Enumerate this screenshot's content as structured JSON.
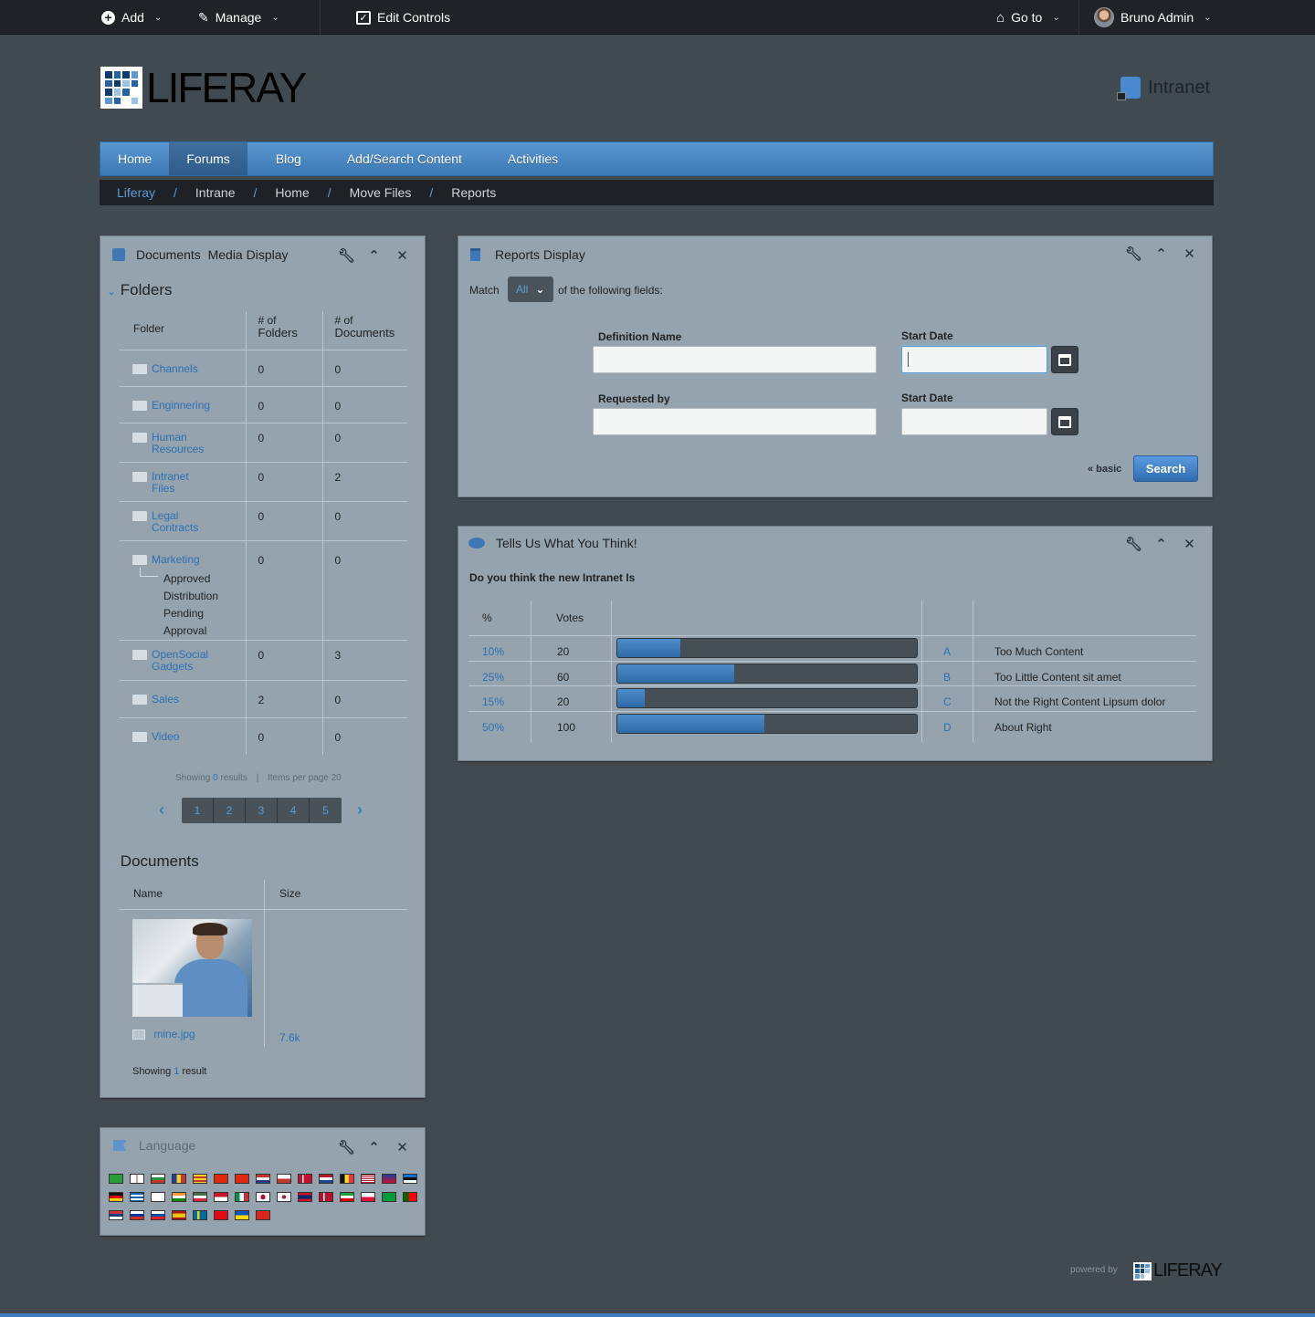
{
  "dockbar": {
    "add_label": "Add",
    "manage_label": "Manage",
    "edit_controls_label": "Edit Controls",
    "goto_label": "Go to",
    "user_name": "Bruno Admin"
  },
  "header": {
    "logo_text": "LIFERAY",
    "site_name": "Intranet"
  },
  "nav": {
    "items": [
      {
        "label": "Home"
      },
      {
        "label": "Forums",
        "selected": true
      },
      {
        "label": "Blog"
      },
      {
        "label": "Add/Search Content"
      },
      {
        "label": "Activities"
      }
    ]
  },
  "breadcrumb": {
    "items": [
      "Liferay",
      "Intrane",
      "Home",
      "Move Files",
      "Reports"
    ]
  },
  "documents_portlet": {
    "title": "Documents  Media Display",
    "folders_heading": "Folders",
    "col_folder": "Folder",
    "col_folders_1": "# of",
    "col_folders_2": "Folders",
    "col_docs_1": "# of",
    "col_docs_2": "Documents",
    "rows": [
      {
        "name1": "Channels",
        "name2": "",
        "folders": "0",
        "docs": "0"
      },
      {
        "name1": "Enginnering",
        "name2": "",
        "folders": "0",
        "docs": "0"
      },
      {
        "name1": "Human",
        "name2": "Resources",
        "folders": "0",
        "docs": "0"
      },
      {
        "name1": "Intranet",
        "name2": "Files",
        "folders": "0",
        "docs": "2"
      },
      {
        "name1": "Legal",
        "name2": "Contracts",
        "folders": "0",
        "docs": "0"
      },
      {
        "name1": "Marketing",
        "name2": "",
        "folders": "0",
        "docs": "0"
      },
      {
        "name1": "OpenSocial",
        "name2": "Gadgets",
        "folders": "0",
        "docs": "3"
      },
      {
        "name1": "Sales",
        "name2": "",
        "folders": "2",
        "docs": "0"
      },
      {
        "name1": "Video",
        "name2": "",
        "folders": "0",
        "docs": "0"
      }
    ],
    "marketing_sub": [
      "Approved",
      "Distribution",
      "Pending",
      "Approval"
    ],
    "showing_prefix": "Showing",
    "showing_count": "0",
    "showing_suffix": "results",
    "items_per_page": "Items per page 20",
    "pages": [
      "1",
      "2",
      "3",
      "4",
      "5"
    ],
    "documents_heading": "Documents",
    "col_name": "Name",
    "col_size": "Size",
    "doc_name": "mine.jpg",
    "doc_size": "7.6k",
    "doc_showing_prefix": "Showing",
    "doc_showing_count": "1",
    "doc_showing_suffix": "result"
  },
  "reports_portlet": {
    "title": "Reports Display",
    "match_label": "Match",
    "match_value": "All",
    "match_suffix": "of the following fields:",
    "definition_name_label": "Definition Name",
    "start_date_label": "Start Date",
    "requested_by_label": "Requested by",
    "start_date2_label": "Start Date",
    "basic_link": "« basic",
    "search_button": "Search"
  },
  "poll_portlet": {
    "title": "Tells Us What You Think!",
    "question": "Do you think the new Intranet Is",
    "col_percent": "%",
    "col_votes": "Votes",
    "rows": [
      {
        "percent": "10%",
        "votes": "20",
        "fraction": 0.21,
        "letter": "A",
        "choice": "Too Much Content"
      },
      {
        "percent": "25%",
        "votes": "60",
        "fraction": 0.39,
        "letter": "B",
        "choice": "Too Little Content sit amet"
      },
      {
        "percent": "15%",
        "votes": "20",
        "fraction": 0.09,
        "letter": "C",
        "choice": "Not the Right Content Lipsum dolor"
      },
      {
        "percent": "50%",
        "votes": "100",
        "fraction": 0.49,
        "letter": "D",
        "choice": "About Right"
      }
    ]
  },
  "language_portlet": {
    "title": "Language"
  },
  "footer": {
    "powered_by": "powered by",
    "logo_text": "LIFERAY"
  },
  "colors": {
    "accent": "#3f7bbf",
    "background": "#424a51",
    "portlet": "#94a3ae",
    "dockbar": "#1f2226"
  }
}
